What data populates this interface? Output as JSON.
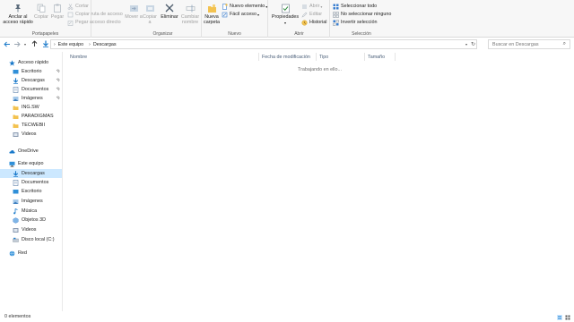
{
  "ribbon": {
    "portapapeles": {
      "label": "Portapapeles",
      "pin": "Anclar al acceso rápido",
      "copy": "Copiar",
      "paste": "Pegar",
      "cut": "Cortar",
      "copy_path": "Copiar ruta de acceso",
      "paste_shortcut": "Pegar acceso directo"
    },
    "organizar": {
      "label": "Organizar",
      "move": "Mover a",
      "copy_to": "Copiar a",
      "delete": "Eliminar",
      "rename": "Cambiar nombre"
    },
    "nuevo": {
      "label": "Nuevo",
      "new_folder": "Nueva carpeta",
      "new_item": "Nuevo elemento",
      "easy_access": "Fácil acceso"
    },
    "abrir": {
      "label": "Abrir",
      "properties": "Propiedades",
      "open": "Abrir",
      "edit": "Editar",
      "history": "Historial"
    },
    "seleccion": {
      "label": "Selección",
      "select_all": "Seleccionar todo",
      "select_none": "No seleccionar ninguno",
      "invert": "Invertir selección"
    }
  },
  "address": {
    "crumbs": [
      "Este equipo",
      "Descargas"
    ],
    "search_placeholder": "Buscar en Descargas"
  },
  "navpane": {
    "quick_access": "Acceso rápido",
    "quick_items": [
      "Escritorio",
      "Descargas",
      "Documentos",
      "Imágenes",
      "ING.SW",
      "PARADIGMAS",
      "TECWEBII",
      "Videos"
    ],
    "onedrive": "OneDrive",
    "this_pc": "Este equipo",
    "pc_items": [
      "Descargas",
      "Documentos",
      "Escritorio",
      "Imágenes",
      "Música",
      "Objetos 3D",
      "Videos",
      "Disco local (C:)"
    ],
    "network": "Red"
  },
  "filelist": {
    "columns": [
      "Nombre",
      "Fecha de modificación",
      "Tipo",
      "Tamaño"
    ],
    "status_message": "Trabajando en ello..."
  },
  "statusbar": {
    "count": "0 elementos"
  },
  "colors": {
    "accent": "#1979ca",
    "selected_bg": "#cce8ff",
    "folder": "#f3c24f"
  }
}
